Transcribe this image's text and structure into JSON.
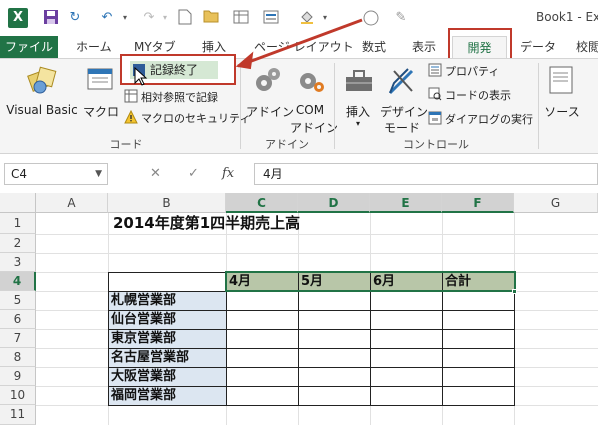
{
  "window": {
    "title": "Book1 - Ex"
  },
  "quick_access": {
    "icons": [
      "excel-logo",
      "save-icon",
      "redo-icon",
      "undo-icon",
      "redo-icon",
      "new-file-icon",
      "open-folder-icon",
      "save-icon",
      "form-icon",
      "fill-icon",
      "record-macro-icon",
      "design-mode-icon"
    ]
  },
  "tabs": [
    {
      "label": "ファイル",
      "id": "file"
    },
    {
      "label": "ホーム",
      "id": "home"
    },
    {
      "label": "MYタブ",
      "id": "mytab"
    },
    {
      "label": "挿入",
      "id": "insert"
    },
    {
      "label": "ページ レイアウト",
      "id": "page-layout"
    },
    {
      "label": "数式",
      "id": "formulas"
    },
    {
      "label": "表示",
      "id": "view"
    },
    {
      "label": "開発",
      "id": "developer"
    },
    {
      "label": "データ",
      "id": "data"
    },
    {
      "label": "校閲",
      "id": "review"
    }
  ],
  "ribbon": {
    "code_group": {
      "label": "コード",
      "visual_basic": "Visual Basic",
      "macros": "マクロ",
      "stop_recording": "記録終了",
      "relative_refs": "相対参照で記録",
      "macro_security": "マクロのセキュリティ"
    },
    "addins_group": {
      "label": "アドイン",
      "addins": "アドイン",
      "com_addins_1": "COM",
      "com_addins_2": "アドイン"
    },
    "controls_group": {
      "label": "コントロール",
      "insert": "挿入",
      "design_mode_1": "デザイン",
      "design_mode_2": "モード",
      "properties": "プロパティ",
      "view_code": "コードの表示",
      "run_dialog": "ダイアログの実行"
    },
    "source": "ソース"
  },
  "formula_bar": {
    "name_box": "C4",
    "cancel": "✕",
    "enter": "✓",
    "fx": "fx",
    "value": "4月"
  },
  "grid": {
    "columns": [
      "A",
      "B",
      "C",
      "D",
      "E",
      "F",
      "G"
    ],
    "rows": [
      "1",
      "2",
      "3",
      "4",
      "5",
      "6",
      "7",
      "8",
      "9",
      "10",
      "11"
    ],
    "selected_cell": "C4",
    "title": "2014年度第1四半期売上高",
    "months": [
      "4月",
      "5月",
      "6月",
      "合計"
    ],
    "branches": [
      "札幌営業部",
      "仙台営業部",
      "東京営業部",
      "名古屋営業部",
      "大阪営業部",
      "福岡営業部"
    ]
  },
  "colors": {
    "excel_green": "#217346",
    "highlight_red": "#c0392b",
    "header_fill": "#b8c6a8",
    "branch_fill": "#dce6f1"
  }
}
